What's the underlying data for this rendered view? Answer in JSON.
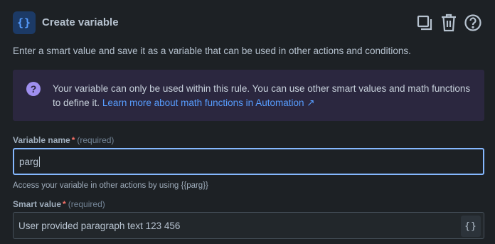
{
  "header": {
    "icon_glyph": "{}",
    "title": "Create variable",
    "actions": [
      "duplicate-icon",
      "trash-icon",
      "help-icon"
    ]
  },
  "description": "Enter a smart value and save it as a variable that can be used in other actions and conditions.",
  "info": {
    "text": "Your variable can only be used within this rule. You can use other smart values and math functions to define it.",
    "link_text": "Learn more about math functions in Automation ↗"
  },
  "variable_name": {
    "label": "Variable name",
    "required_text": "(required)",
    "value": "parg",
    "helper": "Access your variable in other actions by using {{parg}}"
  },
  "smart_value": {
    "label": "Smart value",
    "required_text": "(required)",
    "value": "User provided paragraph text 123 456",
    "button_glyph": "{}"
  },
  "colors": {
    "background": "#1d2125",
    "accent": "#579dff",
    "info_panel": "#2b273f",
    "required": "#f87168",
    "focus_border": "#85b8ff"
  }
}
